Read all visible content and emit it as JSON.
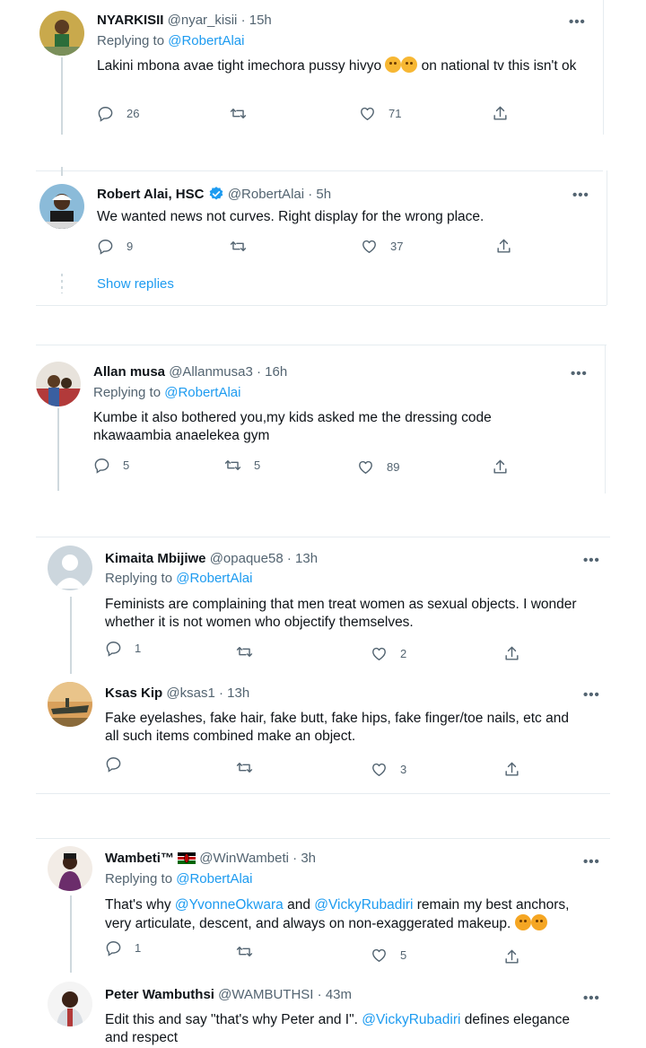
{
  "tweets": [
    {
      "name": "NYARKISII",
      "handle": "@nyar_kisii",
      "time": "· 15h",
      "replying_label": "Replying to ",
      "replying_handle": "@RobertAlai",
      "text": "Lakini mbona avae tight imechora pussy hivyo",
      "text_after": " on national tv this isn't ok",
      "replies": "26",
      "retweets": "",
      "likes": "71"
    },
    {
      "name": "Robert Alai, HSC",
      "handle": "@RobertAlai",
      "time": "· 5h",
      "text": "We wanted news not curves. Right display for the wrong place.",
      "replies": "9",
      "retweets": "",
      "likes": "37",
      "show_replies": "Show replies"
    },
    {
      "name": "Allan musa",
      "handle": "@Allanmusa3",
      "time": "· 16h",
      "replying_label": "Replying to ",
      "replying_handle": "@RobertAlai",
      "text_line1": "Kumbe it also bothered you,my kids asked me the dressing code",
      "text_line2": "nkawaambia anaelekea gym",
      "replies": "5",
      "retweets": "5",
      "likes": "89"
    },
    {
      "name": "Kimaita Mbijiwe",
      "handle": "@opaque58",
      "time": "· 13h",
      "replying_label": "Replying to ",
      "replying_handle": "@RobertAlai",
      "text_line1": "Feminists are complaining that men treat women as sexual objects. I wonder",
      "text_line2": "whether it is not women who objectify themselves.",
      "replies": "1",
      "retweets": "",
      "likes": "2"
    },
    {
      "name": "Ksas Kip",
      "handle": "@ksas1",
      "time": "· 13h",
      "text_line1": "Fake eyelashes, fake hair, fake butt, fake hips, fake finger/toe nails, etc and",
      "text_line2": "all such items combined make an object.",
      "replies": "",
      "retweets": "",
      "likes": "3"
    },
    {
      "name": "Wambeti™",
      "handle": "@WinWambeti",
      "time": "· 3h",
      "replying_label": "Replying to ",
      "replying_handle": "@RobertAlai",
      "text_pre": "That's why ",
      "mention1": "@YvonneOkwara",
      "text_mid": " and ",
      "mention2": "@VickyRubadiri",
      "text_post": "  remain my best anchors,",
      "text_line2": "very articulate, descent, and always on non-exaggerated makeup.",
      "replies": "1",
      "retweets": "",
      "likes": "5"
    },
    {
      "name": "Peter Wambuthsi",
      "handle": "@WAMBUTHSI",
      "time": "· 43m",
      "text_pre": "Edit this and say \"that's why Peter and I\". ",
      "mention1": "@VickyRubadiri",
      "text_post": " defines elegance",
      "text_line2": "and respect"
    }
  ],
  "more_label": "•••",
  "colors": {
    "link": "#1d9bf0",
    "muted": "#536471",
    "verified": "#1d9bf0"
  }
}
